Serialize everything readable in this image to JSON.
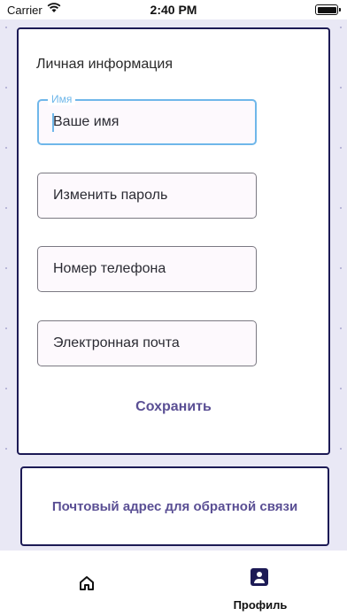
{
  "status_bar": {
    "carrier": "Carrier",
    "time": "2:40 PM"
  },
  "personal_info": {
    "title": "Личная информация",
    "fields": [
      {
        "label": "Имя",
        "placeholder": "Ваше имя"
      },
      {
        "placeholder": "Изменить пароль"
      },
      {
        "placeholder": "Номер телефона"
      },
      {
        "placeholder": "Электронная почта"
      }
    ],
    "save_label": "Сохранить"
  },
  "address": {
    "link_label": "Почтовый адрес для обратной связи"
  },
  "tab_bar": {
    "home": {
      "icon": "home-icon"
    },
    "profile": {
      "icon": "profile-icon",
      "label": "Профиль"
    }
  },
  "colors": {
    "accent": "#5a4f94",
    "card_border": "#1c1a55",
    "focus": "#6fb7ea",
    "background": "#e9e8f5"
  }
}
